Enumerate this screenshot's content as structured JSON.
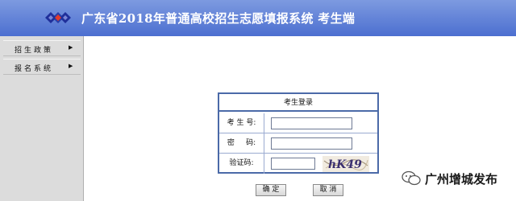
{
  "header": {
    "title": "广东省2018年普通高校招生志愿填报系统 考生端"
  },
  "sidebar": {
    "items": [
      {
        "label": "招生政策",
        "arrow": "▶"
      },
      {
        "label": "报名系统",
        "arrow": "▶"
      }
    ]
  },
  "login": {
    "title": "考生登录",
    "fields": [
      {
        "label": "考 生 号:",
        "value": ""
      },
      {
        "label": "密     码:",
        "value": ""
      },
      {
        "label": "验证码:",
        "value": ""
      }
    ],
    "captcha_text": "hK49"
  },
  "buttons": {
    "ok": "确 定",
    "cancel": "取 消"
  },
  "watermark": {
    "text": "广州增城发布"
  },
  "colors": {
    "header_top": "#7d9ae0",
    "header_bottom": "#4c6fd0",
    "border": "#4b6aa8",
    "sidebar_bg": "#dcdcdc"
  },
  "icons": {
    "logo": "diamond-logo-icon",
    "wechat": "wechat-icon",
    "arrow": "triangle-right-icon"
  }
}
